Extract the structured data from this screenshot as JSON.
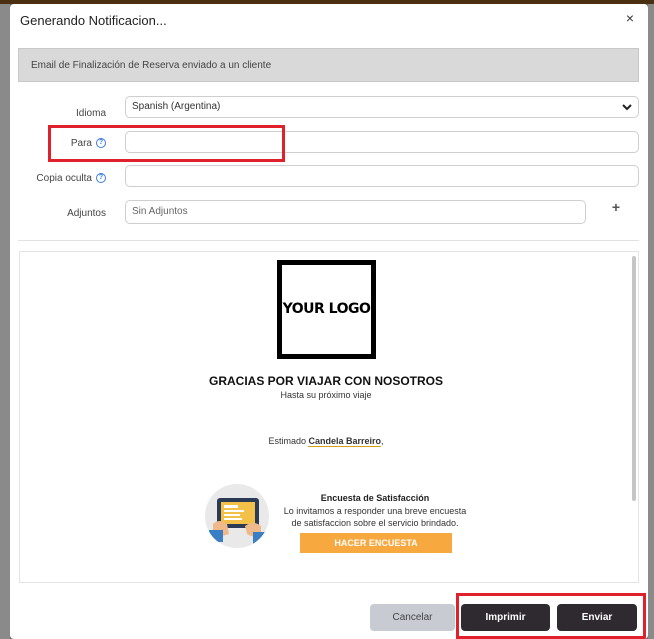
{
  "modal": {
    "title": "Generando Notificacion...",
    "close_symbol": "×",
    "info_text": "Email de Finalización de Reserva enviado a un cliente"
  },
  "form": {
    "idioma_label": "Idioma",
    "idioma_value": "Spanish (Argentina)",
    "para_label": "Para",
    "para_value": "",
    "copia_label": "Copia oculta",
    "copia_value": "",
    "adjuntos_label": "Adjuntos",
    "adjuntos_placeholder": "Sin Adjuntos",
    "add_symbol": "+"
  },
  "preview": {
    "logo_text": "YOUR LOGO",
    "thanks": "GRACIAS POR VIAJAR CON NOSOTROS",
    "sub": "Hasta su próximo viaje",
    "greeting_prefix": "Estimado ",
    "customer_name": "Candela Barreiro",
    "greeting_suffix": ",",
    "survey_title": "Encuesta de Satisfacción",
    "survey_text": "Lo invitamos a responder una breve encuesta de satisfaccion sobre el servicio brindado.",
    "survey_button": "HACER ENCUESTA"
  },
  "footer": {
    "cancel_label": "Cancelar",
    "print_label": "Imprimir",
    "send_label": "Enviar"
  },
  "colors": {
    "highlight": "#e0202a",
    "survey_button": "#f7a83e",
    "dark_button": "#2e2a2f",
    "help_icon": "#3b7dd8"
  }
}
